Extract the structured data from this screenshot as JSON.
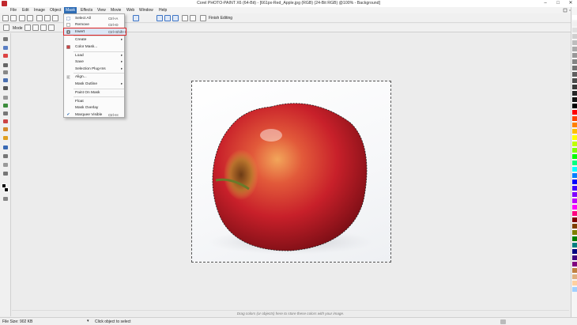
{
  "window": {
    "title": "Corel PHOTO-PAINT X6 (64-Bit) - [661px-Red_Apple.jpg (RGB) (24-Bit RGB) @100% - Background]",
    "min_label": "–",
    "max_label": "□",
    "close_label": "✕"
  },
  "menubar": {
    "items": [
      {
        "label": "File"
      },
      {
        "label": "Edit"
      },
      {
        "label": "Image"
      },
      {
        "label": "Object"
      },
      {
        "label": "Mask"
      },
      {
        "label": "Effects"
      },
      {
        "label": "View"
      },
      {
        "label": "Movie"
      },
      {
        "label": "Web"
      },
      {
        "label": "Window"
      },
      {
        "label": "Help"
      }
    ]
  },
  "toolbar": {
    "finish_editing": "Finish Editing"
  },
  "propbar": {
    "mode_label": "Mode"
  },
  "mask_menu": {
    "select_all": "Select All",
    "select_all_short": "Ctrl+A",
    "remove": "Remove",
    "remove_short": "Ctrl+D",
    "invert": "Invert",
    "invert_short": "Ctrl+Shift+I",
    "create": "Create",
    "color_mask": "Color Mask...",
    "load": "Load",
    "save": "Save",
    "selection_plugin": "Selection Plug-Ins",
    "align": "Align...",
    "mask_outline": "Mask Outline",
    "paint_on_mask": "Paint On Mask",
    "float": "Float",
    "mask_overlay": "Mask Overlay",
    "marquee_visible": "Marquee Visible",
    "marquee_visible_short": "Ctrl+H"
  },
  "hint": {
    "text": "Drag colors (or objects) here to store these colors with your image."
  },
  "status": {
    "file_size": "File Size: 902 KB",
    "arrow": "▾",
    "message": "Click object to select"
  },
  "colors": {
    "accent": "#2d6cb5",
    "highlight_outline": "#dd2222",
    "apple_red": "#c8202a"
  }
}
